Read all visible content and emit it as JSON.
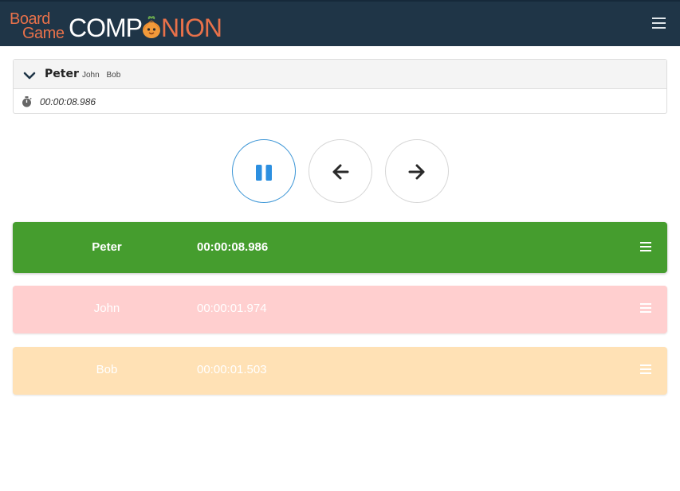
{
  "brand": {
    "line1": "Board",
    "line2": "Game",
    "word_start": "COMP",
    "word_end": "NION",
    "accent_color": "#e8714a",
    "navbar_color": "#1f3547"
  },
  "nav": {
    "menu_icon": "hamburger-icon"
  },
  "current": {
    "player": "Peter",
    "others": [
      "John",
      "Bob"
    ],
    "elapsed": "00:00:08.986",
    "toggle_icon": "chevron-down-icon",
    "timer_icon": "stopwatch-icon"
  },
  "controls": {
    "pause_icon": "pause-icon",
    "prev_icon": "arrow-left-icon",
    "next_icon": "arrow-right-icon",
    "pause_color": "#3b95d6"
  },
  "players": [
    {
      "name": "Peter",
      "time": "00:00:08.986",
      "color": "#459d2e"
    },
    {
      "name": "John",
      "time": "00:00:01.974",
      "color": "#ffcfcf"
    },
    {
      "name": "Bob",
      "time": "00:00:01.503",
      "color": "#ffe1b5"
    }
  ]
}
